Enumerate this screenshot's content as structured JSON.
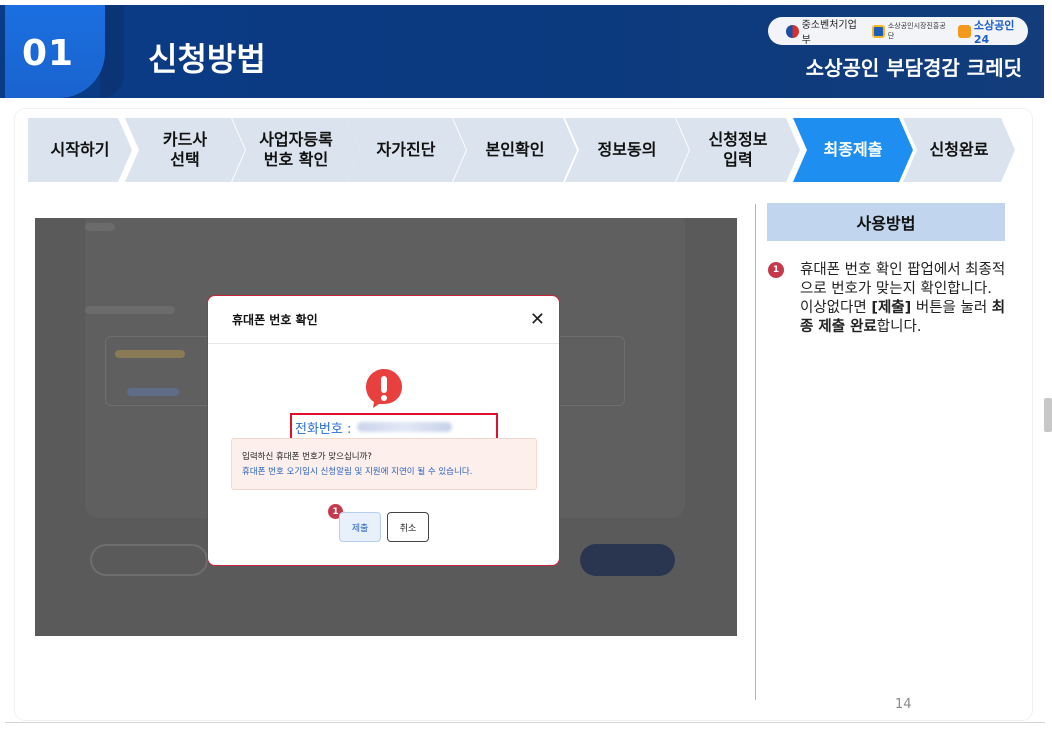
{
  "header": {
    "section_number": "01",
    "section_title": "신청방법",
    "logos": [
      "중소벤처기업부",
      "소상공인시장진흥공단",
      "소상공인24"
    ],
    "brand": "소상공인 부담경감 크레딧",
    "colors": {
      "band": "#0c3a7f",
      "badge": "#1a63cf"
    }
  },
  "steps": [
    {
      "label": "시작하기",
      "active": false
    },
    {
      "label": "카드사\n선택",
      "active": false
    },
    {
      "label": "사업자등록\n번호 확인",
      "active": false
    },
    {
      "label": "자가진단",
      "active": false
    },
    {
      "label": "본인확인",
      "active": false
    },
    {
      "label": "정보동의",
      "active": false
    },
    {
      "label": "신청정보\n입력",
      "active": false
    },
    {
      "label": "최종제출",
      "active": true
    },
    {
      "label": "신청완료",
      "active": false
    }
  ],
  "modal": {
    "title": "휴대폰 번호 확인",
    "close_icon": "close-icon",
    "alert_icon": "exclamation-speech-bubble-icon",
    "phone_label": "전화번호 :",
    "warning_line1": "입력하신 휴대폰 번호가 맞으십니까?",
    "warning_line2": "휴대폰 번호 오기입시 신청알림 및 지원에 지연이 될 수 있습니다.",
    "submit_label": "제출",
    "cancel_label": "취소",
    "marker": "1"
  },
  "usage": {
    "title": "사용방법",
    "marker": "1",
    "line1": "휴대폰 번호 확인 팝업에서 최종적으로 번호가 맞는지 확인합니다.",
    "line2_pre": "이상없다면 ",
    "line2_bold1": "[제출]",
    "line2_mid": " 버튼을 눌러 ",
    "line2_bold2": "최종 제출 완료",
    "line2_post": "합니다."
  },
  "page_number": "14",
  "colors": {
    "active_step": "#1e8ef0",
    "inactive_step": "#dbe3ee",
    "marker": "#c4394b",
    "highlight": "#e0102a"
  }
}
